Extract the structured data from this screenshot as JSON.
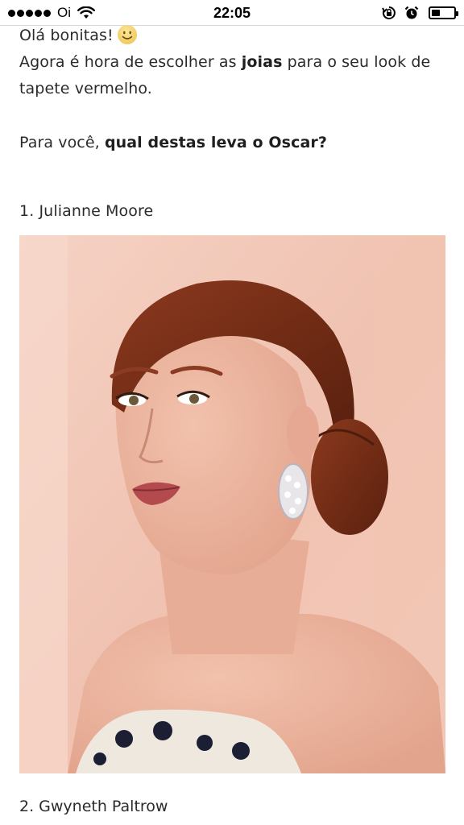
{
  "status_bar": {
    "carrier": "Oi",
    "time": "22:05",
    "battery_level": 0.4
  },
  "post": {
    "greeting": "Olá bonitas!",
    "intro_part1": "Agora é hora de escolher as ",
    "intro_bold": "joias",
    "intro_part2": " para o seu look de",
    "intro_line2": "tapete vermelho.",
    "question_part1": "Para você, ",
    "question_bold": "qual destas leva o Oscar?",
    "items": [
      {
        "label": "1. Julianne Moore"
      },
      {
        "label": "2. Gwyneth Paltrow"
      }
    ]
  },
  "colors": {
    "photo_background": "#f2c9b9",
    "hair": "#7a2e17",
    "skin": "#edb7a0"
  }
}
